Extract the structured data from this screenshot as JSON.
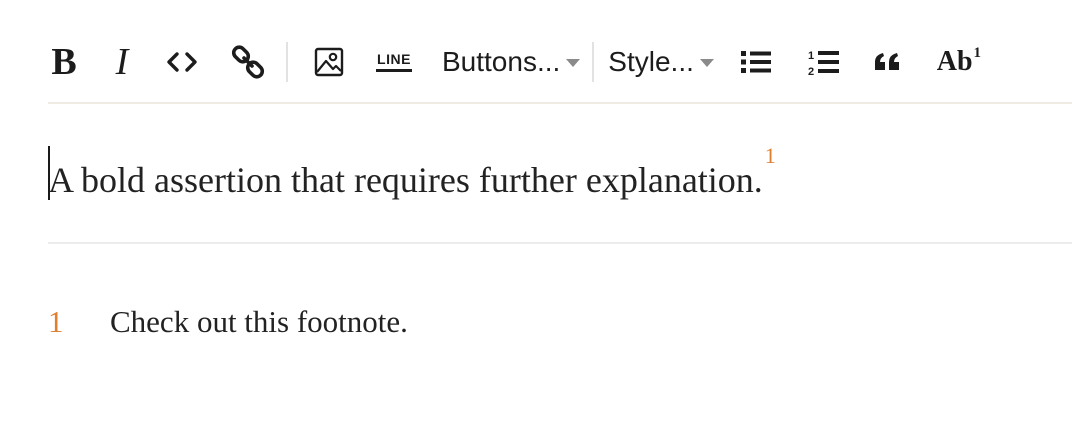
{
  "accent_color": "#e07f2f",
  "toolbar": {
    "bold": {
      "label": "B",
      "icon": "bold-icon"
    },
    "italic": {
      "label": "I",
      "icon": "italic-icon"
    },
    "code": {
      "icon": "code-icon"
    },
    "link": {
      "icon": "link-icon"
    },
    "image": {
      "icon": "image-icon"
    },
    "line": {
      "label": "LINE",
      "icon": "horizontal-rule-icon"
    },
    "buttons_dropdown": {
      "label": "Buttons..."
    },
    "style_dropdown": {
      "label": "Style..."
    },
    "bullet_list": {
      "icon": "bulleted-list-icon"
    },
    "numbered_list": {
      "icon": "numbered-list-icon"
    },
    "blockquote": {
      "icon": "quote-icon"
    },
    "footnote": {
      "label": "Ab",
      "sup": "1",
      "icon": "footnote-icon"
    }
  },
  "content": {
    "paragraph": "A bold assertion that requires further explanation.",
    "footnote_ref": "1"
  },
  "footnotes": [
    {
      "number": "1",
      "text": "Check out this footnote."
    }
  ]
}
